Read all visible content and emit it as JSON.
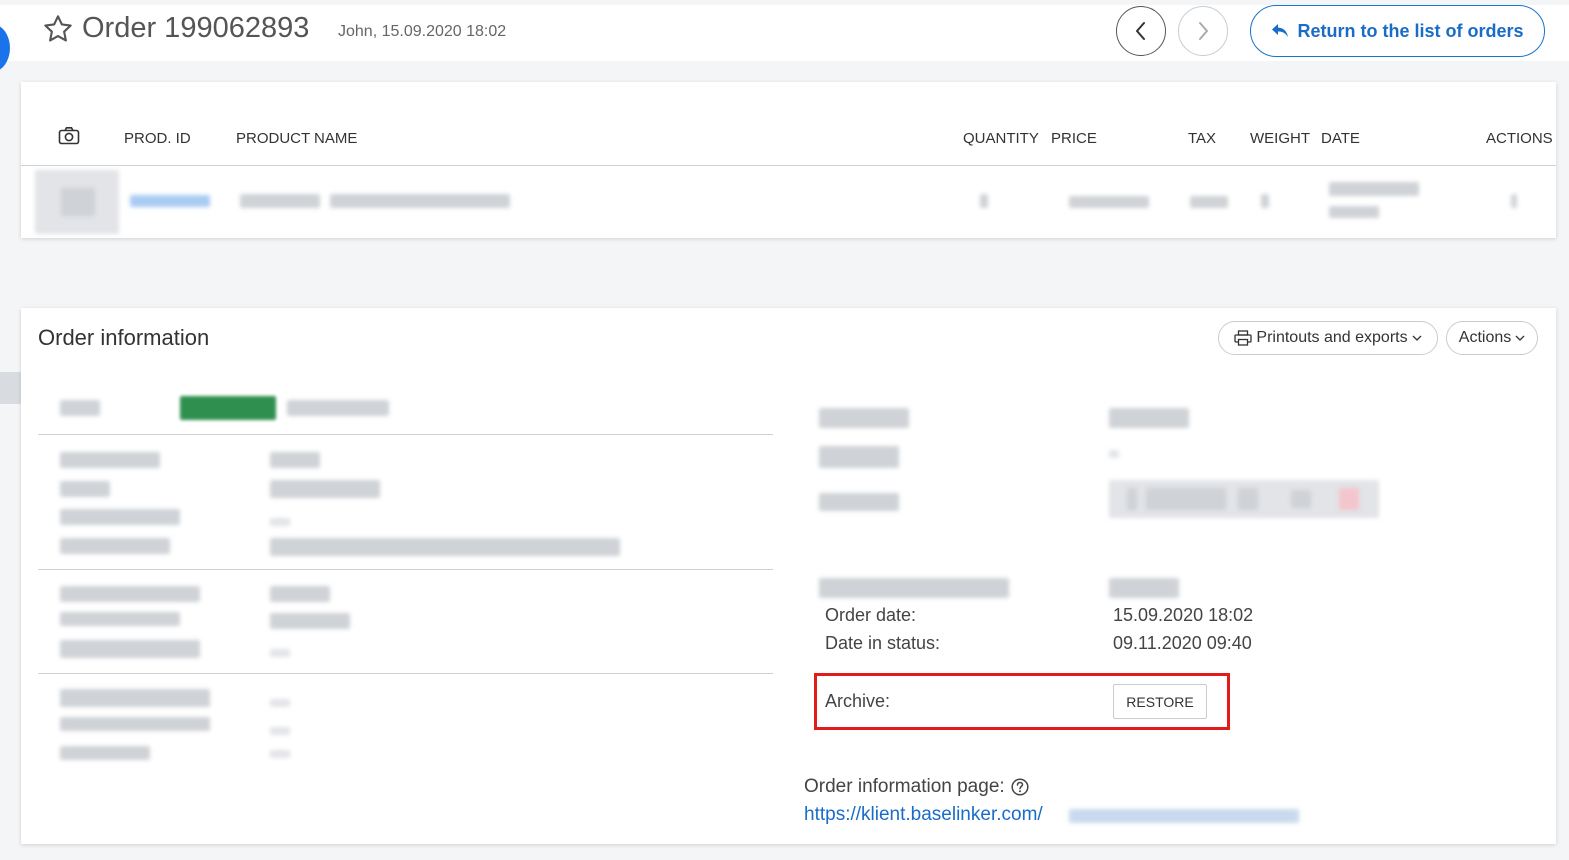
{
  "header": {
    "order_title": "Order 199062893",
    "order_meta": "John, 15.09.2020 18:02",
    "return_label": "Return to the list of orders"
  },
  "product_table": {
    "columns": [
      "PROD. ID",
      "PRODUCT NAME",
      "QUANTITY",
      "PRICE",
      "TAX",
      "WEIGHT",
      "DATE",
      "ACTIONS"
    ]
  },
  "order_info": {
    "title": "Order information",
    "printouts_label": "Printouts and exports",
    "actions_label": "Actions",
    "order_date_label": "Order date:",
    "order_date_value": "15.09.2020 18:02",
    "date_in_status_label": "Date in status:",
    "date_in_status_value": "09.11.2020 09:40",
    "archive_label": "Archive:",
    "restore_label": "RESTORE",
    "info_page_label": "Order information page:",
    "info_page_link": "https://klient.baselinker.com/"
  },
  "colors": {
    "accent": "#1a6cc9",
    "highlight_border": "#e31b1b"
  }
}
